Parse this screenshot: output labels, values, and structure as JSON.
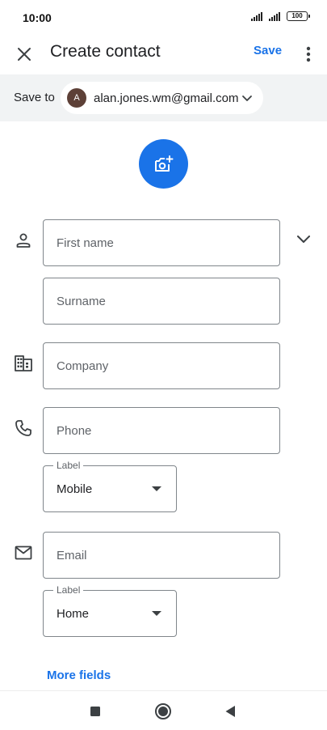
{
  "status_bar": {
    "time": "10:00",
    "battery": "100"
  },
  "app_bar": {
    "title": "Create contact",
    "save_label": "Save"
  },
  "account": {
    "save_to_label": "Save to",
    "avatar_initial": "A",
    "email": "alan.jones.wm@gmail.com"
  },
  "fields": {
    "first_name": {
      "placeholder": "First name"
    },
    "surname": {
      "placeholder": "Surname"
    },
    "company": {
      "placeholder": "Company"
    },
    "phone": {
      "placeholder": "Phone",
      "label_caption": "Label",
      "label_value": "Mobile"
    },
    "email": {
      "placeholder": "Email",
      "label_caption": "Label",
      "label_value": "Home"
    }
  },
  "more_fields_label": "More fields",
  "icons": {
    "close": "close-icon",
    "more": "more-vert-icon",
    "chevron": "chevron-down-icon",
    "photo": "add-photo-icon",
    "person": "person-icon",
    "company": "business-icon",
    "phone": "phone-icon",
    "email": "mail-icon"
  },
  "colors": {
    "accent": "#1a73e8",
    "account_bar_bg": "#f1f3f4",
    "avatar_bg": "#5d4037"
  }
}
